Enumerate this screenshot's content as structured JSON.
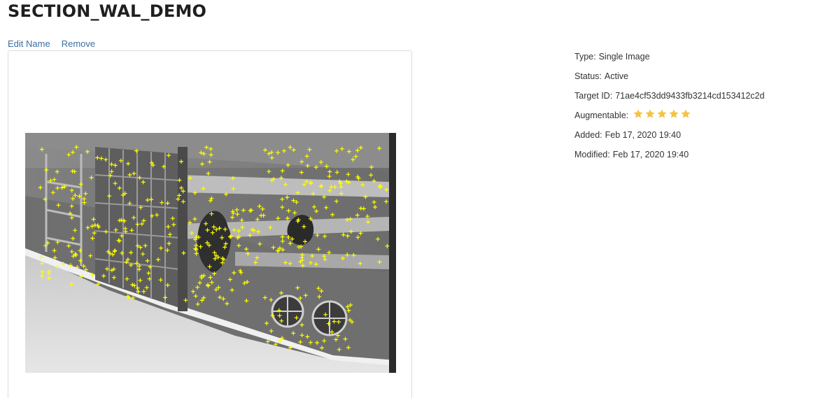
{
  "header": {
    "title": "SECTION_WAL_DEMO",
    "edit_name": "Edit Name",
    "remove": "Remove"
  },
  "target": {
    "image_icon": "target-image-with-feature-points",
    "feature_color": "#ffff00"
  },
  "info": {
    "type_label": "Type:",
    "type_value": "Single Image",
    "status_label": "Status:",
    "status_value": "Active",
    "target_id_label": "Target ID:",
    "target_id_value": "71ae4cf53dd9433fb3214cd153412c2d",
    "augmentable_label": "Augmentable:",
    "augmentable_rating": 5,
    "augmentable_max": 5,
    "star_color": "#f5c242",
    "added_label": "Added:",
    "added_value": "Feb 17, 2020 19:40",
    "modified_label": "Modified:",
    "modified_value": "Feb 17, 2020 19:40"
  }
}
